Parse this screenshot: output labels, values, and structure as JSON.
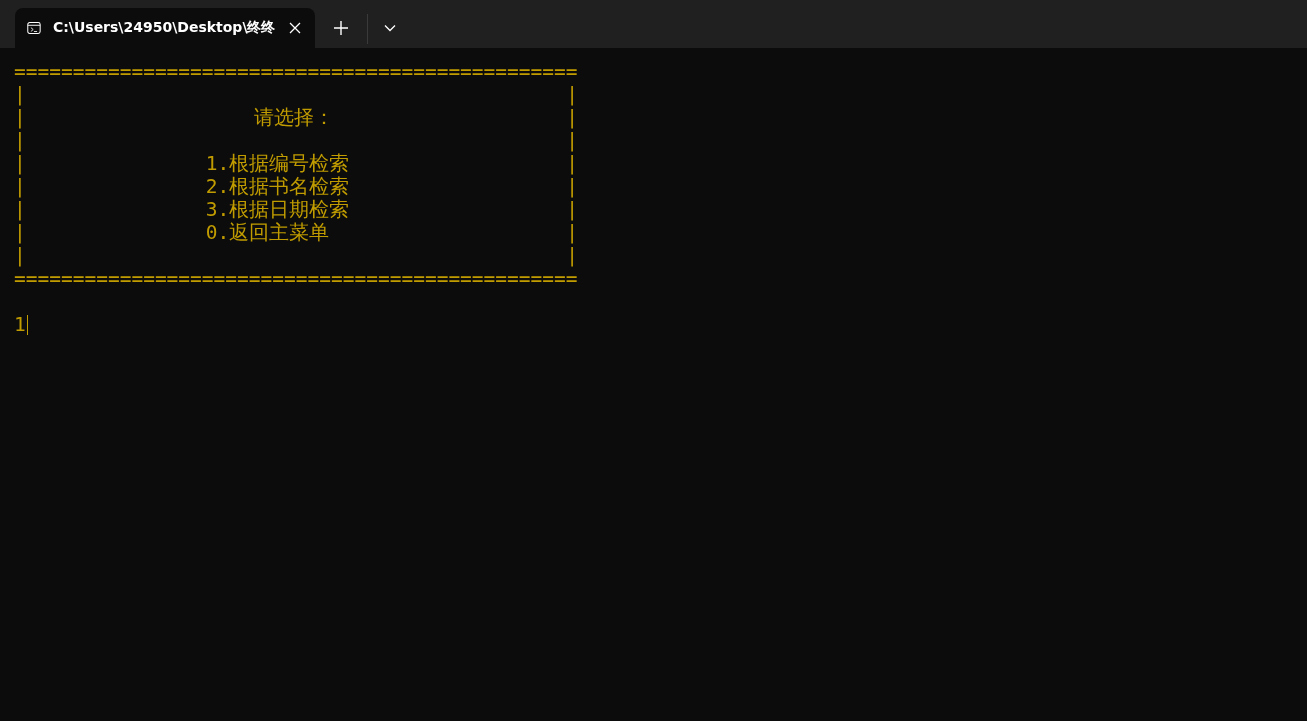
{
  "window": {
    "tab": {
      "title": "C:\\Users\\24950\\Desktop\\终终",
      "selected": true
    }
  },
  "console": {
    "lines": [
      {
        "kind": "rule",
        "text": "================================================"
      },
      {
        "kind": "blank",
        "left": "|",
        "right": "|"
      },
      {
        "kind": "heading",
        "left": "|",
        "text": "请选择：",
        "right": "|"
      },
      {
        "kind": "blank",
        "left": "|",
        "right": "|"
      },
      {
        "kind": "item",
        "left": "|",
        "text": "1.根据编号检索",
        "right": "|"
      },
      {
        "kind": "item",
        "left": "|",
        "text": "2.根据书名检索",
        "right": "|"
      },
      {
        "kind": "item",
        "left": "|",
        "text": "3.根据日期检索",
        "right": "|"
      },
      {
        "kind": "item",
        "left": "|",
        "text": "0.返回主菜单",
        "right": "|"
      },
      {
        "kind": "blank",
        "left": "|",
        "right": "|"
      },
      {
        "kind": "rule",
        "text": "================================================"
      }
    ],
    "input": "1"
  }
}
